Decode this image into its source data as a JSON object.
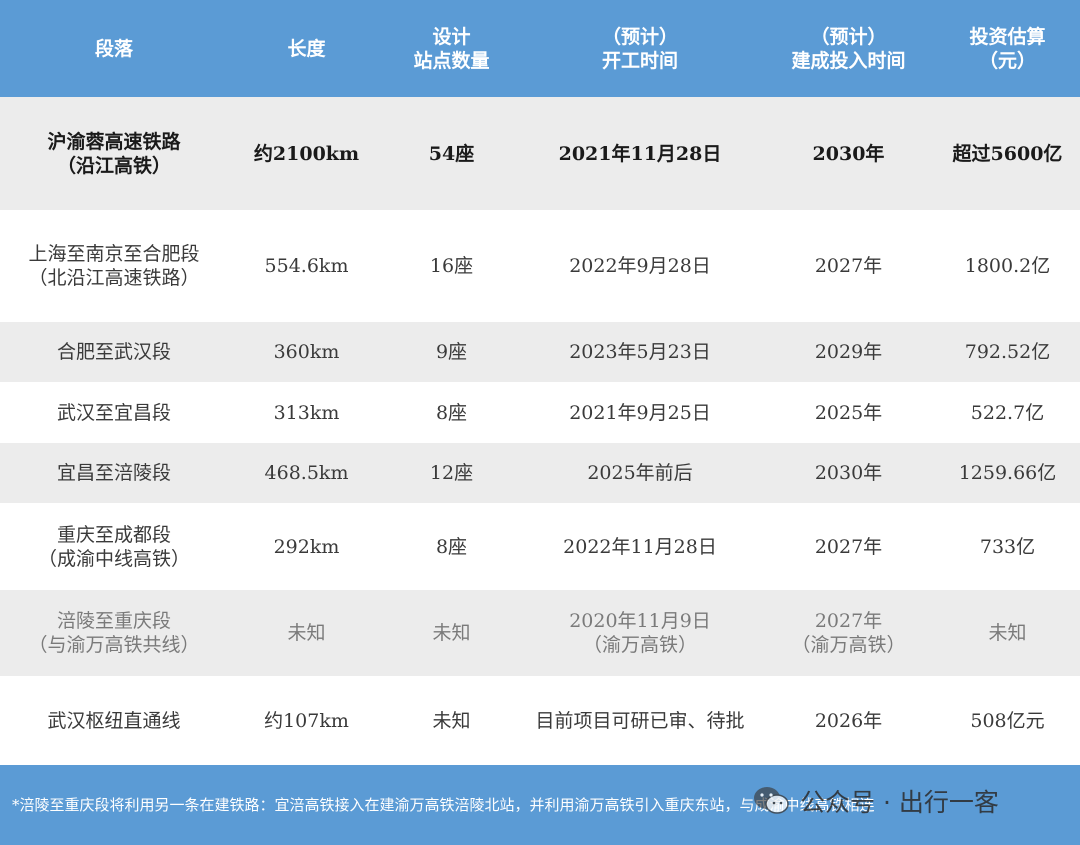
{
  "table": {
    "headers": [
      [
        "段落"
      ],
      [
        "长度"
      ],
      [
        "设计",
        "站点数量"
      ],
      [
        "（预计）",
        "开工时间"
      ],
      [
        "（预计）",
        "建成投入时间"
      ],
      [
        "投资估算",
        "（元）"
      ]
    ],
    "rows": [
      {
        "segment": [
          "沪渝蓉高速铁路",
          "（沿江高铁）"
        ],
        "length": [
          "约2100km"
        ],
        "stations": [
          "54座"
        ],
        "start": [
          "2021年11月28日"
        ],
        "completion": [
          "2030年"
        ],
        "investment": [
          "超过5600亿"
        ]
      },
      {
        "segment": [
          "上海至南京至合肥段",
          "（北沿江高速铁路）"
        ],
        "length": [
          "554.6km"
        ],
        "stations": [
          "16座"
        ],
        "start": [
          "2022年9月28日"
        ],
        "completion": [
          "2027年"
        ],
        "investment": [
          "1800.2亿"
        ]
      },
      {
        "segment": [
          "合肥至武汉段"
        ],
        "length": [
          "360km"
        ],
        "stations": [
          "9座"
        ],
        "start": [
          "2023年5月23日"
        ],
        "completion": [
          "2029年"
        ],
        "investment": [
          "792.52亿"
        ]
      },
      {
        "segment": [
          "武汉至宜昌段"
        ],
        "length": [
          "313km"
        ],
        "stations": [
          "8座"
        ],
        "start": [
          "2021年9月25日"
        ],
        "completion": [
          "2025年"
        ],
        "investment": [
          "522.7亿"
        ]
      },
      {
        "segment": [
          "宜昌至涪陵段"
        ],
        "length": [
          "468.5km"
        ],
        "stations": [
          "12座"
        ],
        "start": [
          "2025年前后"
        ],
        "completion": [
          "2030年"
        ],
        "investment": [
          "1259.66亿"
        ]
      },
      {
        "segment": [
          "重庆至成都段",
          "（成渝中线高铁）"
        ],
        "length": [
          "292km"
        ],
        "stations": [
          "8座"
        ],
        "start": [
          "2022年11月28日"
        ],
        "completion": [
          "2027年"
        ],
        "investment": [
          "733亿"
        ]
      },
      {
        "segment": [
          "涪陵至重庆段",
          "（与渝万高铁共线）"
        ],
        "length": [
          "未知"
        ],
        "stations": [
          "未知"
        ],
        "start": [
          "2020年11月9日",
          "（渝万高铁）"
        ],
        "completion": [
          "2027年",
          "（渝万高铁）"
        ],
        "investment": [
          "未知"
        ]
      },
      {
        "segment": [
          "武汉枢纽直通线"
        ],
        "length": [
          "约107km"
        ],
        "stations": [
          "未知"
        ],
        "start": [
          "目前项目可研已审、待批"
        ],
        "completion": [
          "2026年"
        ],
        "investment": [
          "508亿元"
        ]
      }
    ]
  },
  "footer": {
    "note": "*涪陵至重庆段将利用另一条在建铁路：宜涪高铁接入在建渝万高铁涪陵北站，并利用渝万高铁引入重庆东站，与成渝中线高铁相连",
    "watermark": "公众号 · 出行一客",
    "watermark_icon": "wechat-icon"
  }
}
